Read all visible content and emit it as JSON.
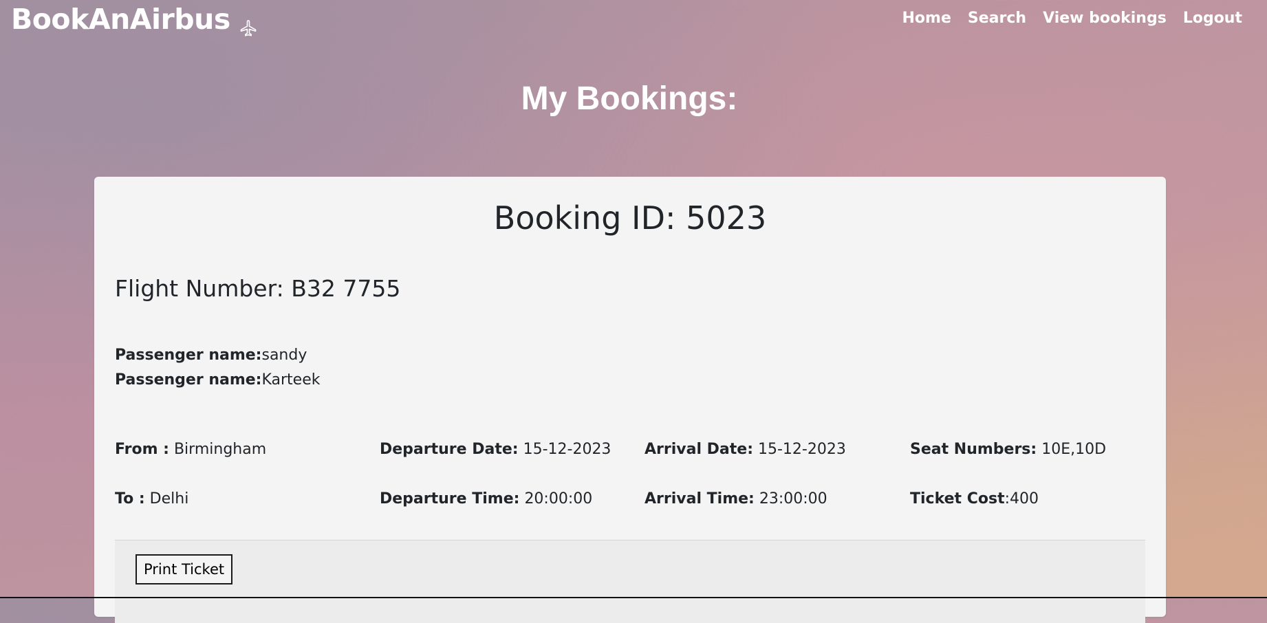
{
  "nav": {
    "brand": "BookAnAirbus",
    "brand_icon": "airplane-icon",
    "links": [
      {
        "label": "Home"
      },
      {
        "label": "Search"
      },
      {
        "label": "View bookings"
      },
      {
        "label": "Logout"
      }
    ]
  },
  "page": {
    "title": "My Bookings:"
  },
  "booking": {
    "id_label": "Booking ID:",
    "id": "5023",
    "flight_label": "Flight Number:",
    "flight_number": "B32 7755",
    "passenger_label": "Passenger name:",
    "passengers": [
      "sandy",
      "Karteek"
    ],
    "from_label": "From :",
    "from": "Birmingham",
    "to_label": "To :",
    "to": "Delhi",
    "departure_date_label": "Departure Date:",
    "departure_date": "15-12-2023",
    "departure_time_label": "Departure Time:",
    "departure_time": "20:00:00",
    "arrival_date_label": "Arrival Date:",
    "arrival_date": "15-12-2023",
    "arrival_time_label": "Arrival Time:",
    "arrival_time": "23:00:00",
    "seat_label": "Seat Numbers:",
    "seats": "10E,10D",
    "cost_label": "Ticket Cost",
    "cost": ":400",
    "print_label": "Print Ticket"
  },
  "colors": {
    "card_background": "#f4f4f4",
    "footer_background": "#ececec",
    "text": "#212529",
    "nav_text": "#ffffff"
  }
}
